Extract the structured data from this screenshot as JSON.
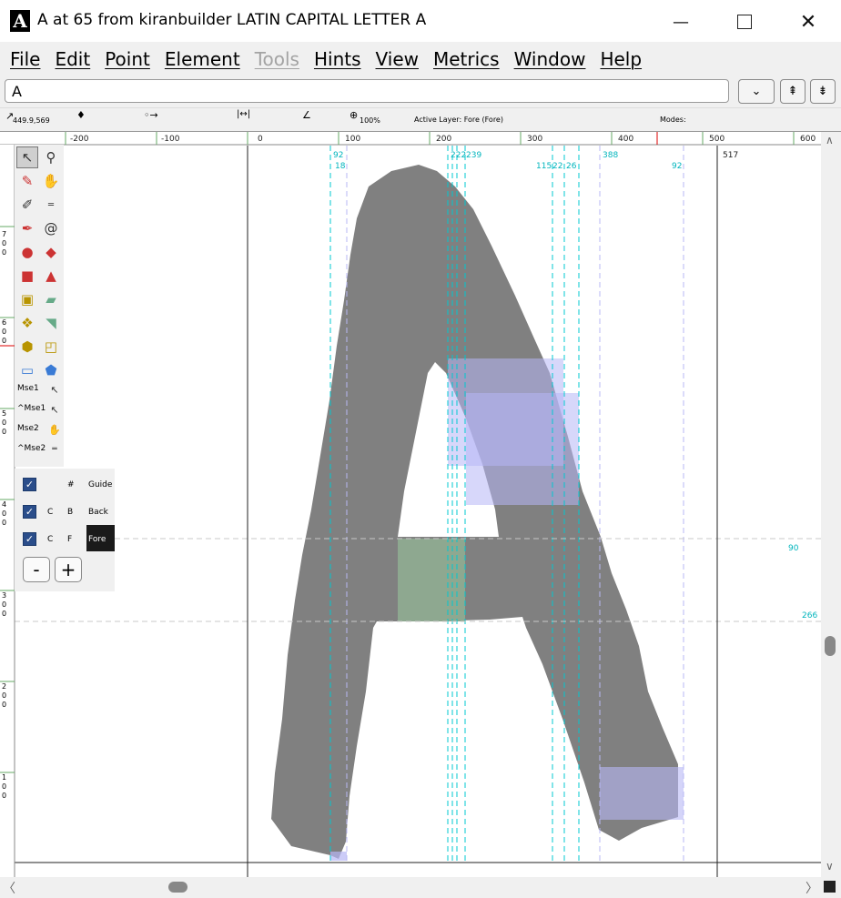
{
  "window": {
    "title": "A at 65 from kiranbuilder LATIN CAPITAL LETTER A",
    "app_icon_letter": "A",
    "controls": [
      "minimize-icon",
      "maximize-icon",
      "close-icon"
    ]
  },
  "menu": [
    "File",
    "Edit",
    "Point",
    "Element",
    "Tools",
    "Hints",
    "View",
    "Metrics",
    "Window",
    "Help"
  ],
  "menu_disabled": [
    "Tools"
  ],
  "glyph_field": {
    "value": "A"
  },
  "info_bar": {
    "coords": "449.9,569",
    "zoom": "100%",
    "active_layer": "Active Layer: Fore (Fore)",
    "modes": "Modes:"
  },
  "ruler": {
    "top_labels": [
      "-200",
      "-100",
      "0",
      "100",
      "200",
      "300",
      "400",
      "500",
      "600"
    ],
    "left_labels": [
      "700",
      "600",
      "500",
      "400",
      "300",
      "200",
      "100"
    ]
  },
  "guide_labels": {
    "top": [
      "92",
      "18",
      "222",
      "239",
      "115",
      "22",
      "26",
      "388",
      "92",
      "517"
    ],
    "right": [
      "90",
      "266"
    ]
  },
  "toolbox": {
    "tools": [
      "pointer-icon",
      "magnify-icon",
      "pencil-icon",
      "hand-icon",
      "knife-icon",
      "ruler-icon",
      "pen-icon",
      "spiral-icon",
      "curve-point-icon",
      "hv-curve-point-icon",
      "corner-point-icon",
      "tangent-point-icon",
      "scale-icon",
      "skew-icon",
      "flip-icon",
      "rotate-icon",
      "rotate-3d-icon",
      "perspective-icon",
      "rectangle-icon",
      "polygon-icon"
    ],
    "mouse_bindings": [
      "Mse1",
      "^Mse1",
      "Mse2",
      "^Mse2"
    ]
  },
  "layers": {
    "rows": [
      {
        "checked": true,
        "c": "",
        "f": "#",
        "name": "Guide"
      },
      {
        "checked": true,
        "c": "C",
        "f": "B",
        "name": "Back"
      },
      {
        "checked": true,
        "c": "C",
        "f": "F",
        "name": "Fore"
      }
    ],
    "remove_label": "-",
    "add_label": "+"
  },
  "colors": {
    "glyph": "#808080",
    "guide": "#00c8d0",
    "hint": "#b7b7f5",
    "hint_green": "#8ea890",
    "ruler_bg": "#ffffff",
    "active_layer_bg": "#1a1a1a"
  }
}
